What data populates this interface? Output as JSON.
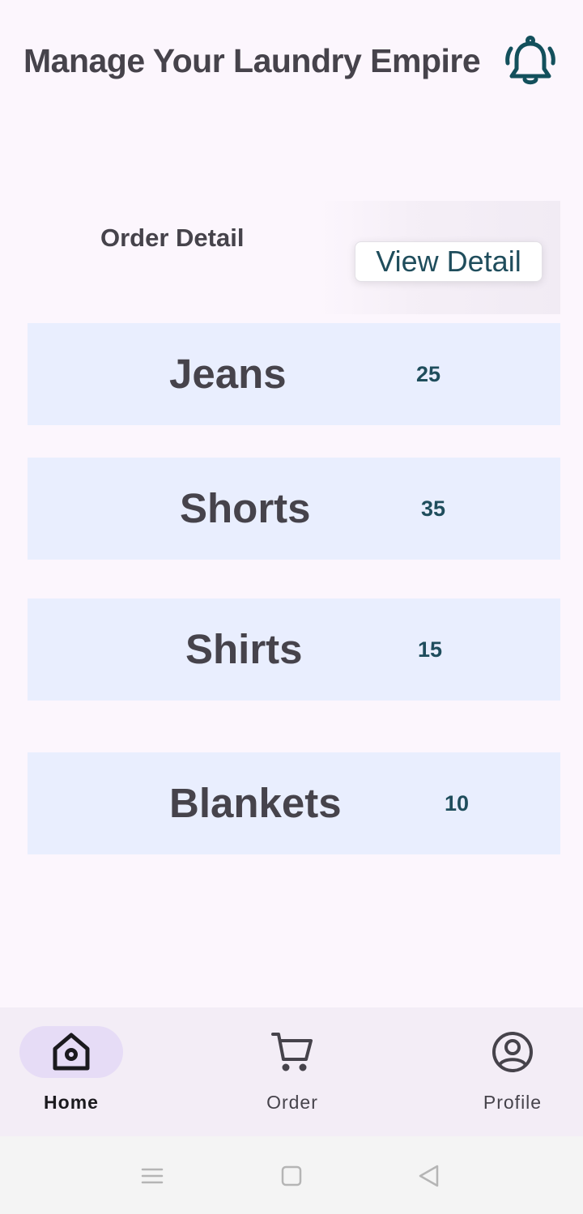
{
  "header": {
    "title": "Manage Your Laundry Empire",
    "notification_icon": "bell-icon"
  },
  "order_section": {
    "title": "Order Detail",
    "view_button_label": "View Detail"
  },
  "items": [
    {
      "name": "Jeans",
      "count": "25"
    },
    {
      "name": "Shorts",
      "count": "35"
    },
    {
      "name": "Shirts",
      "count": "15"
    },
    {
      "name": "Blankets",
      "count": "10"
    }
  ],
  "bottom_nav": {
    "items": [
      {
        "label": "Home",
        "icon": "home-icon",
        "active": true
      },
      {
        "label": "Order",
        "icon": "cart-icon",
        "active": false
      },
      {
        "label": "Profile",
        "icon": "profile-icon",
        "active": false
      }
    ]
  },
  "colors": {
    "background": "#fcf6fd",
    "row_background": "#e9eefe",
    "accent": "#1f4d5c",
    "text": "#46434b",
    "nav_active_pill": "#e6dcf6"
  }
}
